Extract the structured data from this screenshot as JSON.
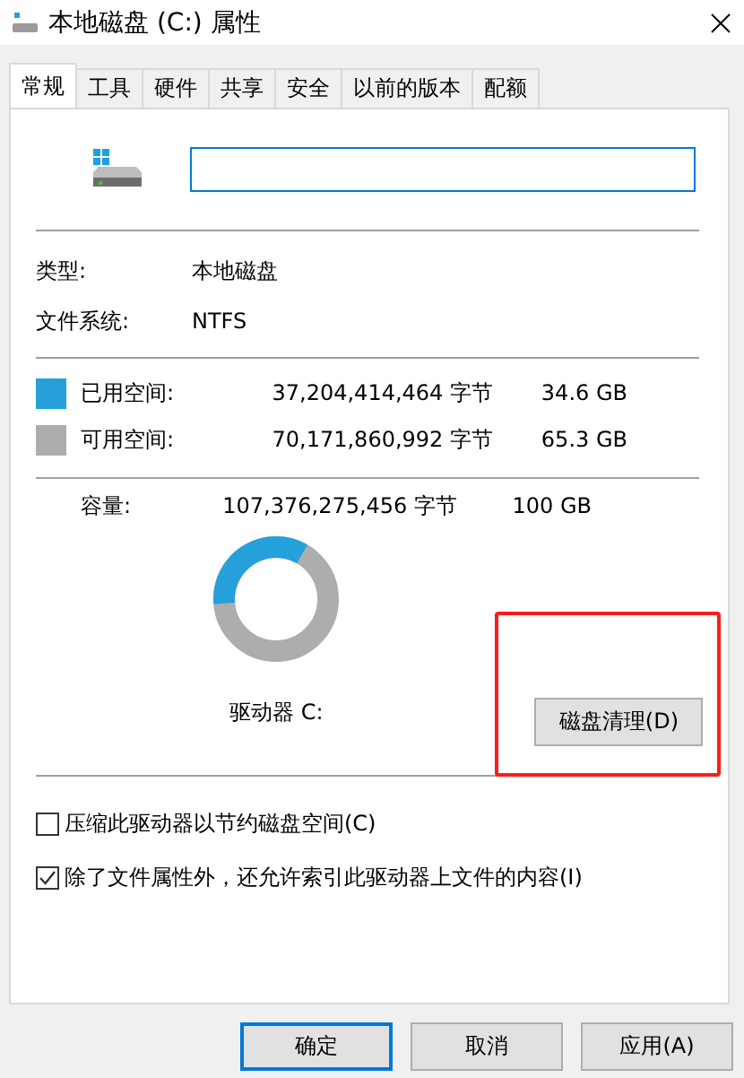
{
  "window": {
    "title": "本地磁盘 (C:) 属性"
  },
  "tabs": [
    {
      "label": "常规",
      "selected": true
    },
    {
      "label": "工具",
      "selected": false
    },
    {
      "label": "硬件",
      "selected": false
    },
    {
      "label": "共享",
      "selected": false
    },
    {
      "label": "安全",
      "selected": false
    },
    {
      "label": "以前的版本",
      "selected": false
    },
    {
      "label": "配额",
      "selected": false
    }
  ],
  "info": [
    {
      "label": "类型:",
      "value": "本地磁盘"
    },
    {
      "label": "文件系统:",
      "value": "NTFS"
    }
  ],
  "space": [
    {
      "label": "已用空间:",
      "bytes": "37,204,414,464 字节",
      "size": "34.6 GB",
      "color": "#26a0da"
    },
    {
      "label": "可用空间:",
      "bytes": "70,171,860,992 字节",
      "size": "65.3 GB",
      "color": "#adadad"
    }
  ],
  "capacity": {
    "label": "容量:",
    "bytes": "107,376,275,456 字节",
    "size": "100 GB"
  },
  "drive_label": "驱动器 C:",
  "cleanup_button": "磁盘清理(D)",
  "options": [
    {
      "label": "压缩此驱动器以节约磁盘空间(C)",
      "checked": false
    },
    {
      "label": "除了文件属性外，还允许索引此驱动器上文件的内容(I)",
      "checked": true
    }
  ],
  "buttons": [
    {
      "label": "确定",
      "default": true
    },
    {
      "label": "取消",
      "default": false
    },
    {
      "label": "应用(A)",
      "default": false
    }
  ]
}
